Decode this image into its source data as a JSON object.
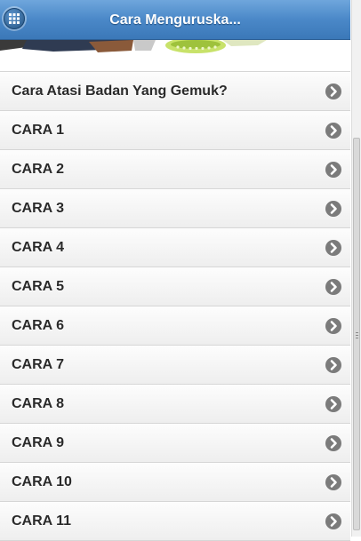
{
  "header": {
    "title": "Cara Menguruska...",
    "menu_icon": "grid-menu-icon"
  },
  "banner": {
    "description_icon": "banner-image-partial"
  },
  "list": {
    "items": [
      {
        "label": "Cara Atasi Badan Yang Gemuk?"
      },
      {
        "label": "CARA 1"
      },
      {
        "label": "CARA 2"
      },
      {
        "label": "CARA 3"
      },
      {
        "label": "CARA 4"
      },
      {
        "label": "CARA 5"
      },
      {
        "label": "CARA 6"
      },
      {
        "label": "CARA 7"
      },
      {
        "label": "CARA 8"
      },
      {
        "label": "CARA 9"
      },
      {
        "label": "CARA 10"
      },
      {
        "label": "CARA 11"
      }
    ],
    "item_icon": "chevron-right-icon"
  },
  "colors": {
    "header": "#4a88c8",
    "chevron": "#7b7b7b",
    "item_text": "#2a2a2a"
  }
}
